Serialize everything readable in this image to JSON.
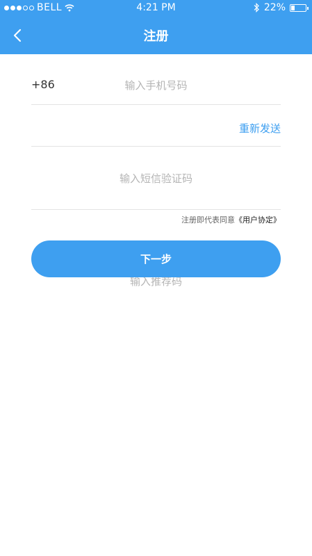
{
  "status_bar": {
    "signal_dots_filled": 3,
    "signal_dots_total": 5,
    "carrier": "BELL",
    "time": "4:21 PM",
    "battery_percent": "22%",
    "battery_level": 0.22
  },
  "nav": {
    "title": "注册",
    "back_icon": "chevron-left-icon"
  },
  "form": {
    "phone_prefix": "+86",
    "phone_placeholder": "输入手机号码",
    "sms_placeholder": "输入短信验证码",
    "resend_label": "重新发送",
    "referral_placeholder": "输入推荐码"
  },
  "agreement": {
    "prefix": "注册即代表同意",
    "link": "《用户协定》"
  },
  "next_button": {
    "label": "下一步"
  },
  "colors": {
    "accent": "#3e9ff0",
    "divider": "#e3e3e3",
    "placeholder": "#b4b4b4"
  }
}
